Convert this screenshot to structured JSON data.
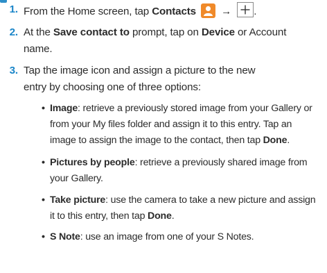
{
  "steps": [
    {
      "number": "1.",
      "prefix": "From the Home screen, tap ",
      "bold": "Contacts",
      "arrow": "→",
      "suffix": ".",
      "icons": [
        "contacts-app-icon",
        "add-plus-icon"
      ]
    },
    {
      "number": "2.",
      "prefix": "At the ",
      "bold1": "Save contact to",
      "mid": " prompt, tap on ",
      "bold2": "Device",
      "suffix": " or Account",
      "line2": "name."
    },
    {
      "number": "3.",
      "line1": "Tap the image icon and assign a picture to the new",
      "line2": "entry by choosing one of three options:"
    }
  ],
  "bullets": [
    {
      "bold": "Image",
      "lines": [
        ": retrieve a previously stored image from your Gallery or",
        "from your My files folder and assign it to this entry. Tap an",
        "image to assign the image to the contact, then tap "
      ],
      "end_bold": "Done",
      "end": "."
    },
    {
      "bold": "Pictures by people",
      "lines": [
        ": retrieve a previously shared image from",
        "your Gallery."
      ]
    },
    {
      "bold": "Take picture",
      "lines": [
        ": use the camera to take a new picture and assign",
        "it to this entry, then tap "
      ],
      "end_bold": "Done",
      "end": "."
    },
    {
      "bold": "S Note",
      "lines": [
        ": use an image from one of your S Notes."
      ]
    }
  ],
  "bullet_glyph": "•",
  "colors": {
    "step_number": "#1a85c8",
    "contacts_icon": "#f08a2a"
  }
}
